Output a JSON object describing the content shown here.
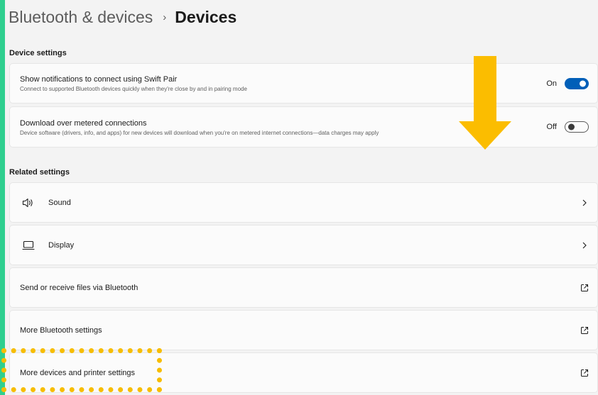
{
  "breadcrumb": {
    "parent": "Bluetooth & devices",
    "separator": "›",
    "current": "Devices"
  },
  "sections": {
    "device_settings": "Device settings",
    "related_settings": "Related settings"
  },
  "device_settings": {
    "swift_pair": {
      "title": "Show notifications to connect using Swift Pair",
      "description": "Connect to supported Bluetooth devices quickly when they're close by and in pairing mode",
      "state_label": "On",
      "on": true
    },
    "metered": {
      "title": "Download over metered connections",
      "description": "Device software (drivers, info, and apps) for new devices will download when you're on metered internet connections—data charges may apply",
      "state_label": "Off",
      "on": false
    }
  },
  "related_settings": [
    {
      "label": "Sound",
      "icon": "speaker-icon",
      "right_icon": "chevron-right-icon"
    },
    {
      "label": "Display",
      "icon": "laptop-icon",
      "right_icon": "chevron-right-icon"
    },
    {
      "label": "Send or receive files via Bluetooth",
      "icon": null,
      "right_icon": "external-link-icon"
    },
    {
      "label": "More Bluetooth settings",
      "icon": null,
      "right_icon": "external-link-icon"
    },
    {
      "label": "More devices and printer settings",
      "icon": null,
      "right_icon": "external-link-icon"
    }
  ],
  "colors": {
    "accent_green": "#2fcf8f",
    "toggle_on": "#005fb8",
    "annotation_yellow": "#f7bd00"
  }
}
